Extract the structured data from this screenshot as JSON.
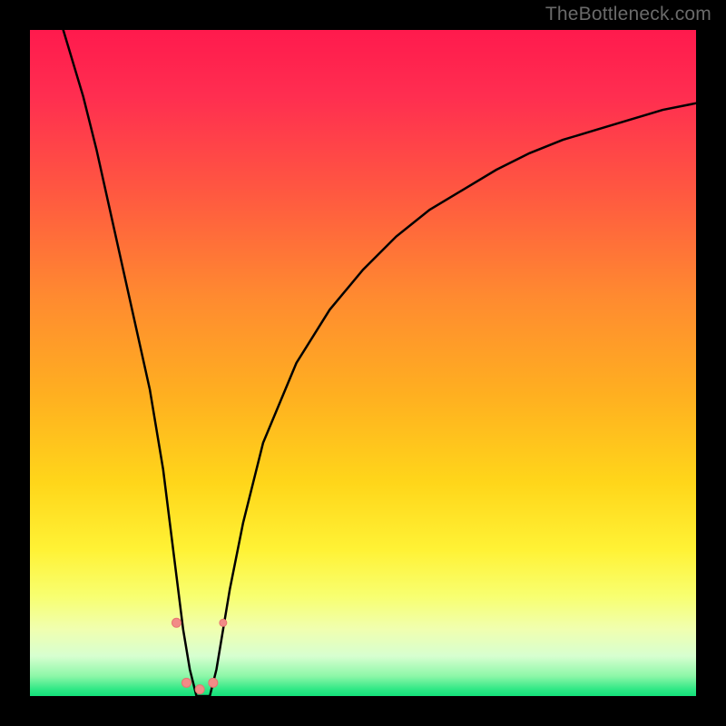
{
  "watermark": {
    "text": "TheBottleneck.com"
  },
  "colors": {
    "frame": "#000000",
    "curve": "#000000",
    "marker_fill": "#f28b87",
    "marker_stroke": "#e77570",
    "gradient_stops": [
      "#ff1a4d",
      "#ff2e50",
      "#ff5a40",
      "#ff8a30",
      "#ffb020",
      "#ffd61a",
      "#fff235",
      "#f8ff70",
      "#f0ffb0",
      "#d7ffd0",
      "#8df7a8",
      "#2fe885",
      "#13e07a"
    ]
  },
  "chart_data": {
    "type": "line",
    "title": "",
    "xlabel": "",
    "ylabel": "",
    "xlim": [
      0,
      100
    ],
    "ylim": [
      0,
      100
    ],
    "grid": false,
    "legend": false,
    "series": [
      {
        "name": "bottleneck-curve",
        "x": [
          5,
          8,
          10,
          12,
          14,
          16,
          18,
          20,
          21,
          22,
          23,
          24,
          25,
          26,
          27,
          28,
          29,
          30,
          32,
          35,
          40,
          45,
          50,
          55,
          60,
          65,
          70,
          75,
          80,
          85,
          90,
          95,
          100
        ],
        "y": [
          100,
          90,
          82,
          73,
          64,
          55,
          46,
          34,
          26,
          18,
          10,
          4,
          0,
          0,
          0,
          4,
          10,
          16,
          26,
          38,
          50,
          58,
          64,
          69,
          73,
          76,
          79,
          81.5,
          83.5,
          85,
          86.5,
          88,
          89
        ]
      }
    ],
    "markers": [
      {
        "x": 22.0,
        "y": 11,
        "r": 5
      },
      {
        "x": 23.5,
        "y": 2,
        "r": 5
      },
      {
        "x": 25.5,
        "y": 1,
        "r": 5
      },
      {
        "x": 27.5,
        "y": 2,
        "r": 5
      },
      {
        "x": 29.0,
        "y": 11,
        "r": 4
      }
    ]
  }
}
